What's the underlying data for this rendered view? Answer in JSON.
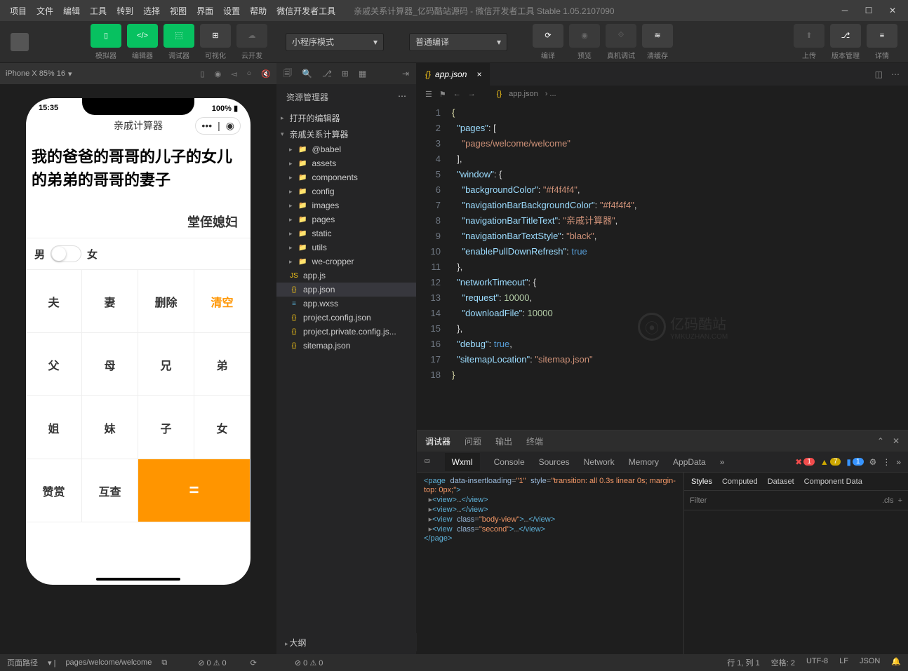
{
  "title": "亲戚关系计算器_亿码酷站源码 - 微信开发者工具 Stable 1.05.2107090",
  "menubar": [
    "项目",
    "文件",
    "编辑",
    "工具",
    "转到",
    "选择",
    "视图",
    "界面",
    "设置",
    "帮助",
    "微信开发者工具"
  ],
  "toolbar": {
    "simulator": "模拟器",
    "editor": "编辑器",
    "debugger": "调试器",
    "visual": "可视化",
    "clouddev": "云开发",
    "mode": "小程序模式",
    "compile_mode": "普通编译",
    "compile": "编译",
    "preview": "预览",
    "remote": "真机调试",
    "cache": "清缓存",
    "upload": "上传",
    "version": "版本管理",
    "detail": "详情"
  },
  "sim": {
    "device": "iPhone X 85% 16",
    "time": "15:35",
    "battery": "100%",
    "navtitle": "亲戚计算器",
    "question": "我的爸爸的哥哥的儿子的女儿的弟弟的哥哥的妻子",
    "answer": "堂侄媳妇",
    "male": "男",
    "female": "女",
    "keys": [
      "夫",
      "妻",
      "删除",
      "清空",
      "父",
      "母",
      "兄",
      "弟",
      "姐",
      "妹",
      "子",
      "女",
      "赞赏",
      "互查",
      "="
    ]
  },
  "explorer": {
    "title": "资源管理器",
    "open": "打开的编辑器",
    "root": "亲戚关系计算器",
    "items": [
      "@babel",
      "assets",
      "components",
      "config",
      "images",
      "pages",
      "static",
      "utils",
      "we-cropper"
    ],
    "files": [
      "app.js",
      "app.json",
      "app.wxss",
      "project.config.json",
      "project.private.config.js...",
      "sitemap.json"
    ],
    "outline": "大纲"
  },
  "tab": {
    "name": "app.json",
    "breadcrumb": "app.json"
  },
  "code": {
    "l1": "{",
    "l2": "\"pages\"",
    "l2v": ": [",
    "l3": "\"pages/welcome/welcome\"",
    "l4": "],",
    "l5": "\"window\"",
    "l5v": ": {",
    "l6k": "\"backgroundColor\"",
    "l6v": "\"#f4f4f4\"",
    "l7k": "\"navigationBarBackgroundColor\"",
    "l7v": "\"#f4f4f4\"",
    "l8k": "\"navigationBarTitleText\"",
    "l8v": "\"亲戚计算器\"",
    "l9k": "\"navigationBarTextStyle\"",
    "l9v": "\"black\"",
    "l10k": "\"enablePullDownRefresh\"",
    "l10v": "true",
    "l11": "},",
    "l12k": "\"networkTimeout\"",
    "l12v": ": {",
    "l13k": "\"request\"",
    "l13v": "10000",
    "l14k": "\"downloadFile\"",
    "l14v": "10000",
    "l15": "},",
    "l16k": "\"debug\"",
    "l16v": "true",
    "l17k": "\"sitemapLocation\"",
    "l17v": "\"sitemap.json\"",
    "l18": "}"
  },
  "watermark": {
    "t1": "亿码酷站",
    "t2": "YMKUZHAN.COM"
  },
  "devtools": {
    "tabs": [
      "调试器",
      "问题",
      "输出",
      "终端"
    ],
    "subtabs": [
      "Wxml",
      "Console",
      "Sources",
      "Network",
      "Memory",
      "AppData"
    ],
    "styles": [
      "Styles",
      "Computed",
      "Dataset",
      "Component Data"
    ],
    "filter": "Filter",
    "cls": ".cls",
    "err": "1",
    "warn": "7",
    "info": "1",
    "wxml1": "<page data-insertloading=\"1\" style=\"transition: all 0.3s linear 0s; margin-top: 0px;\">",
    "wxml2": "<view>…</view>",
    "wxml3": "<view>…</view>",
    "wxml4": "<view class=\"body-view\">…</view>",
    "wxml5": "<view class=\"second\">…</view>",
    "wxml6": "</page>"
  },
  "statusbar": {
    "path": "页面路径",
    "pathval": "pages/welcome/welcome",
    "errs": "⊘ 0 ⚠ 0",
    "line": "行 1, 列 1",
    "spaces": "空格: 2",
    "enc": "UTF-8",
    "eol": "LF",
    "lang": "JSON"
  }
}
